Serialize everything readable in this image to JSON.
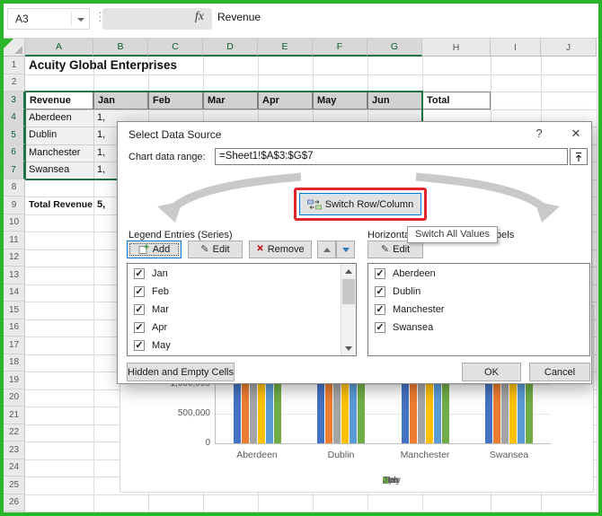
{
  "app": {
    "name_box": "A3",
    "fx_label": "fx",
    "formula_value": "Revenue"
  },
  "icons": {
    "checkbox_check": "✓",
    "edit_pencil": "✎",
    "remove_x": "✕",
    "more_dots": "⋮"
  },
  "sheet": {
    "columns": [
      "A",
      "B",
      "C",
      "D",
      "E",
      "F",
      "G",
      "H",
      "I",
      "J"
    ],
    "rows": [
      "1",
      "2",
      "3",
      "4",
      "5",
      "6",
      "7",
      "8",
      "9",
      "10",
      "11",
      "12",
      "13",
      "14",
      "15",
      "16",
      "17",
      "18",
      "19",
      "20",
      "21",
      "22",
      "23",
      "24",
      "25",
      "26"
    ],
    "cells": [
      {
        "c": "A",
        "r": 1,
        "t": "Acuity Global Enterprises",
        "bold": true,
        "size": 13.5
      },
      {
        "c": "A",
        "r": 3,
        "t": "Revenue",
        "bold": true,
        "box": true
      },
      {
        "c": "B",
        "r": 3,
        "t": "Jan",
        "bold": true,
        "hdr": true
      },
      {
        "c": "C",
        "r": 3,
        "t": "Feb",
        "bold": true,
        "hdr": true
      },
      {
        "c": "D",
        "r": 3,
        "t": "Mar",
        "bold": true,
        "hdr": true
      },
      {
        "c": "E",
        "r": 3,
        "t": "Apr",
        "bold": true,
        "hdr": true
      },
      {
        "c": "F",
        "r": 3,
        "t": "May",
        "bold": true,
        "hdr": true
      },
      {
        "c": "G",
        "r": 3,
        "t": "Jun",
        "bold": true,
        "hdr": true
      },
      {
        "c": "H",
        "r": 3,
        "t": "Total",
        "bold": true,
        "box": true
      },
      {
        "c": "A",
        "r": 4,
        "t": "Aberdeen"
      },
      {
        "c": "B",
        "r": 4,
        "t": "1,"
      },
      {
        "c": "A",
        "r": 5,
        "t": "Dublin"
      },
      {
        "c": "B",
        "r": 5,
        "t": "1,"
      },
      {
        "c": "A",
        "r": 6,
        "t": "Manchester"
      },
      {
        "c": "B",
        "r": 6,
        "t": "1,"
      },
      {
        "c": "A",
        "r": 7,
        "t": "Swansea"
      },
      {
        "c": "B",
        "r": 7,
        "t": "1,"
      },
      {
        "c": "A",
        "r": 9,
        "t": "Total Revenue",
        "bold": true,
        "size": 10.5
      },
      {
        "c": "B",
        "r": 9,
        "t": "5,",
        "bold": true
      }
    ]
  },
  "dialog": {
    "title": "Select Data Source",
    "help_label": "?",
    "close_label": "✕",
    "range_label": "Chart data range:",
    "range_value": "=Sheet1!$A$3:$G$7",
    "switch_button_label": "Switch Row/Column",
    "tooltip": "Switch All Values",
    "legend_section_label": "Legend Entries (Series)",
    "axis_section_label": "Horizontal (Category) Axis Labels",
    "add_label": "Add",
    "edit_label": "Edit",
    "remove_label": "Remove",
    "axis_edit_label": "Edit",
    "legend_items": [
      "Jan",
      "Feb",
      "Mar",
      "Apr",
      "May"
    ],
    "axis_items": [
      "Aberdeen",
      "Dublin",
      "Manchester",
      "Swansea"
    ],
    "hidden_cells_label": "Hidden and Empty Cells",
    "ok_label": "OK",
    "cancel_label": "Cancel"
  },
  "chart": {
    "y_ticks": [
      "1,000,000",
      "500,000",
      "0"
    ],
    "categories": [
      "Aberdeen",
      "Dublin",
      "Manchester",
      "Swansea"
    ],
    "legend": [
      {
        "label": "Jan",
        "color": "#4472C4"
      },
      {
        "label": "Feb",
        "color": "#ED7D31"
      },
      {
        "label": "Mar",
        "color": "#A5A5A5"
      },
      {
        "label": "Apr",
        "color": "#FFC000"
      },
      {
        "label": "May",
        "color": "#5B9BD5"
      },
      {
        "label": "Jun",
        "color": "#70AD47"
      }
    ]
  },
  "chart_data": {
    "type": "bar",
    "categories": [
      "Aberdeen",
      "Dublin",
      "Manchester",
      "Swansea"
    ],
    "series": [
      {
        "name": "Jan"
      },
      {
        "name": "Feb"
      },
      {
        "name": "Mar"
      },
      {
        "name": "Apr"
      },
      {
        "name": "May"
      },
      {
        "name": "Jun"
      }
    ],
    "visible_axis_ticks": [
      0,
      500000,
      1000000
    ],
    "note": "Bar tops are occluded by the Select Data Source dialog; every visible bar extends above the 1,000,000 cut-off line",
    "legend_position": "bottom",
    "grid": true
  },
  "colors": {
    "frame_green": "#2BB52B",
    "selection_border": "#217346",
    "annotation_red": "#E3242B",
    "focus_blue": "#0078D7"
  }
}
